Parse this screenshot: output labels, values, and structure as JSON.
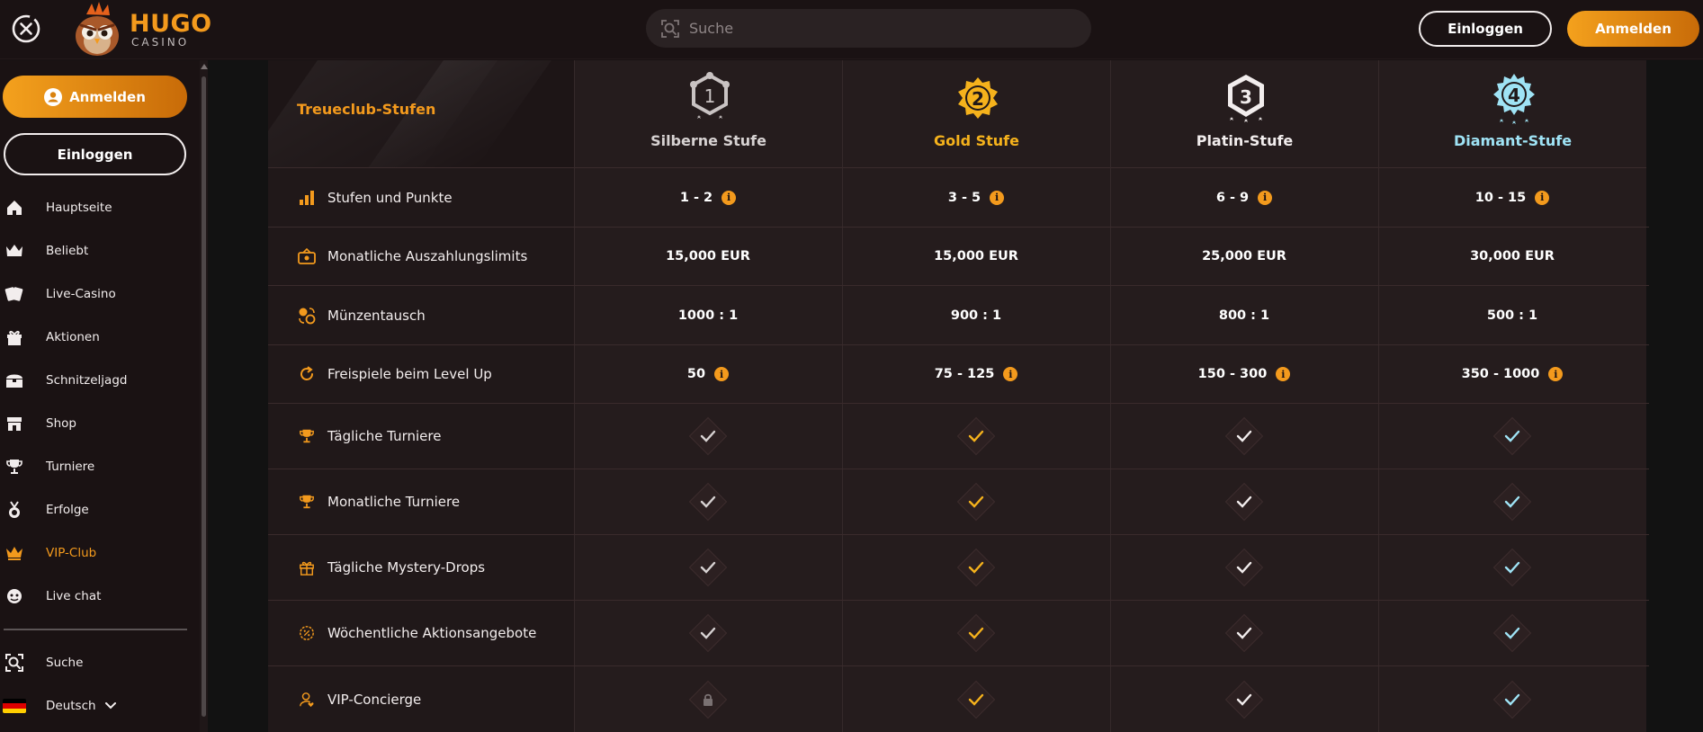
{
  "header": {
    "logo_name": "HUGO",
    "logo_sub": "CASINO",
    "search_placeholder": "Suche",
    "login_label": "Einloggen",
    "register_label": "Anmelden"
  },
  "sidebar": {
    "register_label": "Anmelden",
    "login_label": "Einloggen",
    "items": [
      {
        "label": "Hauptseite",
        "icon": "home-icon"
      },
      {
        "label": "Beliebt",
        "icon": "crown-cards-icon"
      },
      {
        "label": "Live-Casino",
        "icon": "cards-icon"
      },
      {
        "label": "Aktionen",
        "icon": "gift-icon"
      },
      {
        "label": "Schnitzeljagd",
        "icon": "treasure-chest-icon"
      },
      {
        "label": "Shop",
        "icon": "shop-icon"
      },
      {
        "label": "Turniere",
        "icon": "trophy-icon"
      },
      {
        "label": "Erfolge",
        "icon": "medal-icon"
      },
      {
        "label": "VIP-Club",
        "icon": "crown-icon",
        "active": true
      },
      {
        "label": "Live chat",
        "icon": "chat-icon"
      }
    ],
    "search_label": "Suche",
    "language_label": "Deutsch"
  },
  "colors": {
    "accent": "#f39a1d",
    "silver": "#d7d2d2",
    "gold": "#f5b21c",
    "platinum": "#f2eded",
    "diamond": "#9fe3f5"
  },
  "table": {
    "title": "Treueclub-Stufen",
    "tiers": [
      {
        "number": "1",
        "name": "Silberne Stufe",
        "color": "#d7d2d2"
      },
      {
        "number": "2",
        "name": "Gold Stufe",
        "color": "#f5b21c"
      },
      {
        "number": "3",
        "name": "Platin-Stufe",
        "color": "#f2eded"
      },
      {
        "number": "4",
        "name": "Diamant-Stufe",
        "color": "#9fe3f5"
      }
    ],
    "rows": [
      {
        "label": "Stufen und Punkte",
        "icon": "bar-chart-icon",
        "type": "text",
        "values": [
          "1 - 2",
          "3 - 5",
          "6 - 9",
          "10 - 15"
        ],
        "info": [
          true,
          true,
          true,
          true
        ]
      },
      {
        "label": "Monatliche Auszahlungslimits",
        "icon": "cash-icon",
        "type": "text",
        "values": [
          "15,000 EUR",
          "15,000 EUR",
          "25,000 EUR",
          "30,000 EUR"
        ],
        "info": [
          false,
          false,
          false,
          false
        ]
      },
      {
        "label": "Münzentausch",
        "icon": "coin-exchange-icon",
        "type": "text",
        "values": [
          "1000 : 1",
          "900 : 1",
          "800 : 1",
          "500 : 1"
        ],
        "info": [
          false,
          false,
          false,
          false
        ]
      },
      {
        "label": "Freispiele beim Level Up",
        "icon": "refresh-icon",
        "type": "text",
        "values": [
          "50",
          "75 - 125",
          "150 - 300",
          "350 - 1000"
        ],
        "info": [
          true,
          true,
          true,
          true
        ]
      },
      {
        "label": "Tägliche Turniere",
        "icon": "trophy-icon",
        "type": "check",
        "values": [
          "check",
          "check",
          "check",
          "check"
        ]
      },
      {
        "label": "Monatliche Turniere",
        "icon": "trophy-icon",
        "type": "check",
        "values": [
          "check",
          "check",
          "check",
          "check"
        ]
      },
      {
        "label": "Tägliche Mystery-Drops",
        "icon": "gift-icon",
        "type": "check",
        "values": [
          "check",
          "check",
          "check",
          "check"
        ]
      },
      {
        "label": "Wöchentliche Aktionsangebote",
        "icon": "percent-badge-icon",
        "type": "check",
        "values": [
          "check",
          "check",
          "check",
          "check"
        ]
      },
      {
        "label": "VIP-Concierge",
        "icon": "user-heart-icon",
        "type": "check",
        "values": [
          "lock",
          "check",
          "check",
          "check"
        ]
      }
    ]
  }
}
